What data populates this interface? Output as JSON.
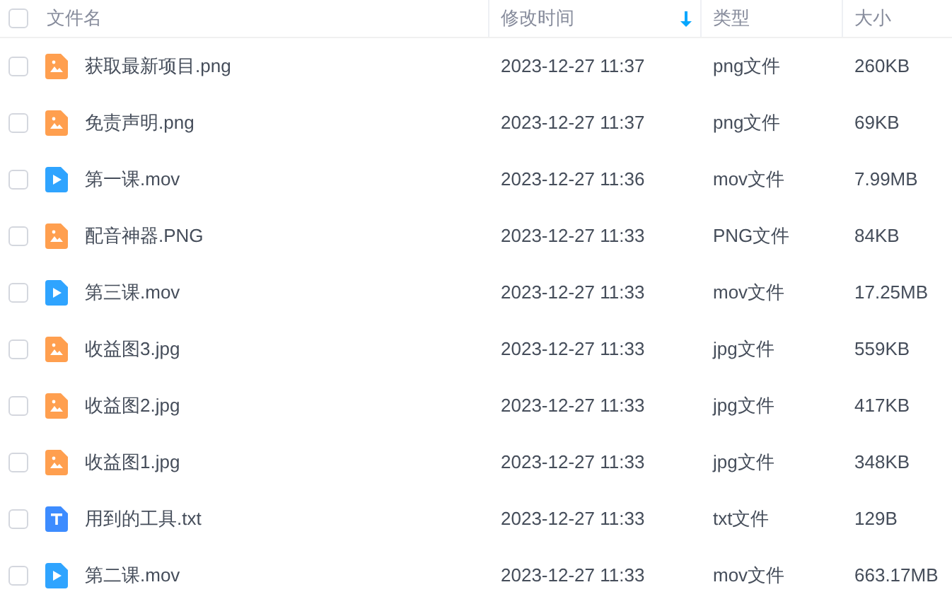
{
  "header": {
    "select_all_checked": false
  },
  "columns": [
    {
      "label": "文件名",
      "sorted": false
    },
    {
      "label": "修改时间",
      "sorted": true
    },
    {
      "label": "类型",
      "sorted": false
    },
    {
      "label": "大小",
      "sorted": false
    }
  ],
  "rows": [
    {
      "kind": "image",
      "checked": false,
      "name": "获取最新项目.png",
      "modified": "2023-12-27 11:37",
      "type": "png文件",
      "size": "260KB"
    },
    {
      "kind": "image",
      "checked": false,
      "name": "免责声明.png",
      "modified": "2023-12-27 11:37",
      "type": "png文件",
      "size": "69KB"
    },
    {
      "kind": "video",
      "checked": false,
      "name": "第一课.mov",
      "modified": "2023-12-27 11:36",
      "type": "mov文件",
      "size": "7.99MB"
    },
    {
      "kind": "image",
      "checked": false,
      "name": "配音神器.PNG",
      "modified": "2023-12-27 11:33",
      "type": "PNG文件",
      "size": "84KB"
    },
    {
      "kind": "video",
      "checked": false,
      "name": "第三课.mov",
      "modified": "2023-12-27 11:33",
      "type": "mov文件",
      "size": "17.25MB"
    },
    {
      "kind": "image",
      "checked": false,
      "name": "收益图3.jpg",
      "modified": "2023-12-27 11:33",
      "type": "jpg文件",
      "size": "559KB"
    },
    {
      "kind": "image",
      "checked": false,
      "name": "收益图2.jpg",
      "modified": "2023-12-27 11:33",
      "type": "jpg文件",
      "size": "417KB"
    },
    {
      "kind": "image",
      "checked": false,
      "name": "收益图1.jpg",
      "modified": "2023-12-27 11:33",
      "type": "jpg文件",
      "size": "348KB"
    },
    {
      "kind": "text",
      "checked": false,
      "name": "用到的工具.txt",
      "modified": "2023-12-27 11:33",
      "type": "txt文件",
      "size": "129B"
    },
    {
      "kind": "video",
      "checked": false,
      "name": "第二课.mov",
      "modified": "2023-12-27 11:33",
      "type": "mov文件",
      "size": "663.17MB"
    }
  ]
}
